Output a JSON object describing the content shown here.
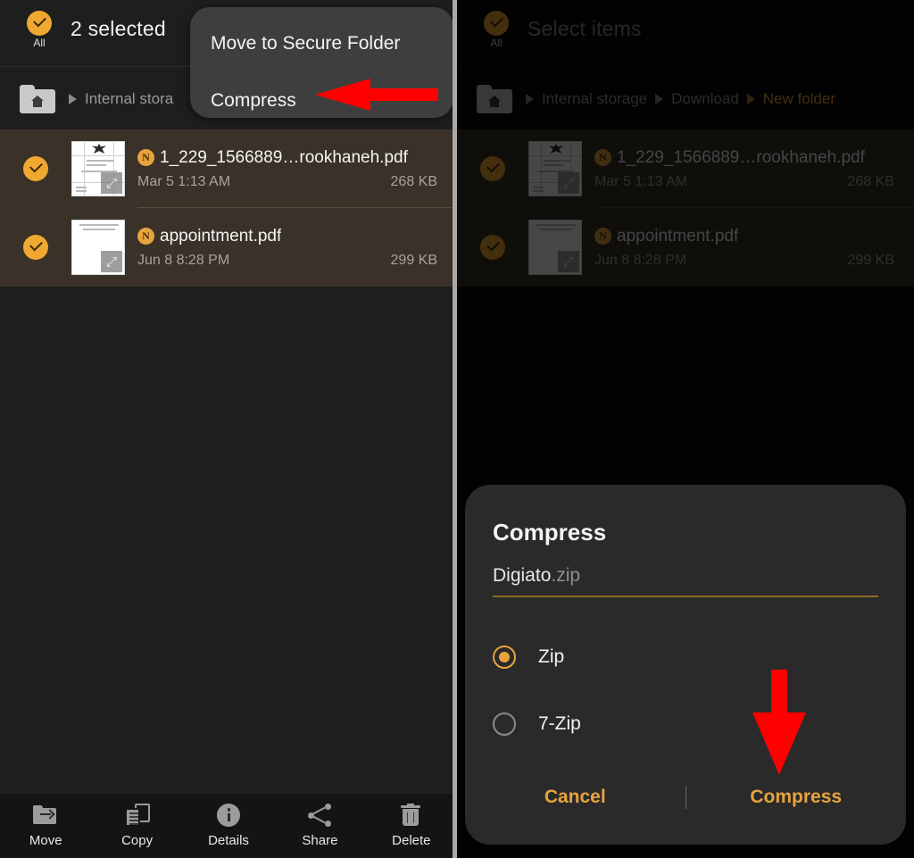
{
  "colors": {
    "accent": "#e8a33d",
    "selected_row_bg": "#3a3228",
    "panel_left_bg": "#1e1e1e",
    "panel_right_bg": "#0a0a0a",
    "dialog_bg": "#2a2a2a",
    "popup_bg": "#3e3e3e",
    "arrow_red": "#ff0000",
    "underline": "#8a6a22"
  },
  "left_panel": {
    "header": {
      "select_all_label": "All",
      "select_all_icon": "circle-check-icon",
      "title": "2 selected"
    },
    "breadcrumb": {
      "home_icon": "home-folder-icon",
      "items": [
        {
          "label": "Internal stora",
          "current": false
        }
      ]
    },
    "files": [
      {
        "checked": true,
        "badge": "N",
        "name": "1_229_1566889…rookhaneh.pdf",
        "date": "Mar 5 1:13 AM",
        "size": "268 KB"
      },
      {
        "checked": true,
        "badge": "N",
        "name": "appointment.pdf",
        "date": "Jun 8 8:28 PM",
        "size": "299 KB"
      }
    ],
    "popup_menu": {
      "items": [
        {
          "label": "Move to Secure Folder"
        },
        {
          "label": "Compress"
        }
      ]
    },
    "bottom_bar": [
      {
        "label": "Move",
        "icon": "move-to-folder-icon"
      },
      {
        "label": "Copy",
        "icon": "copy-icon"
      },
      {
        "label": "Details",
        "icon": "info-icon"
      },
      {
        "label": "Share",
        "icon": "share-icon"
      },
      {
        "label": "Delete",
        "icon": "trash-icon"
      }
    ]
  },
  "right_panel": {
    "header": {
      "select_all_label": "All",
      "select_all_icon": "circle-check-icon",
      "title": "Select items"
    },
    "breadcrumb": {
      "home_icon": "home-folder-icon",
      "items": [
        {
          "label": "Internal storage",
          "current": false
        },
        {
          "label": "Download",
          "current": false
        },
        {
          "label": "New folder",
          "current": true
        }
      ]
    },
    "files": [
      {
        "checked": true,
        "badge": "N",
        "name": "1_229_1566889…rookhaneh.pdf",
        "date": "Mar 5 1:13 AM",
        "size": "268 KB"
      },
      {
        "checked": true,
        "badge": "N",
        "name": "appointment.pdf",
        "date": "Jun 8 8:28 PM",
        "size": "299 KB"
      }
    ],
    "dialog": {
      "title": "Compress",
      "filename_value": "Digiato",
      "filename_extension": ".zip",
      "options": [
        {
          "label": "Zip",
          "selected": true
        },
        {
          "label": "7-Zip",
          "selected": false
        }
      ],
      "cancel_label": "Cancel",
      "confirm_label": "Compress"
    }
  },
  "annotations": [
    {
      "name": "arrow-pointing-compress-menu-item",
      "direction": "left"
    },
    {
      "name": "arrow-pointing-compress-button",
      "direction": "down"
    }
  ]
}
